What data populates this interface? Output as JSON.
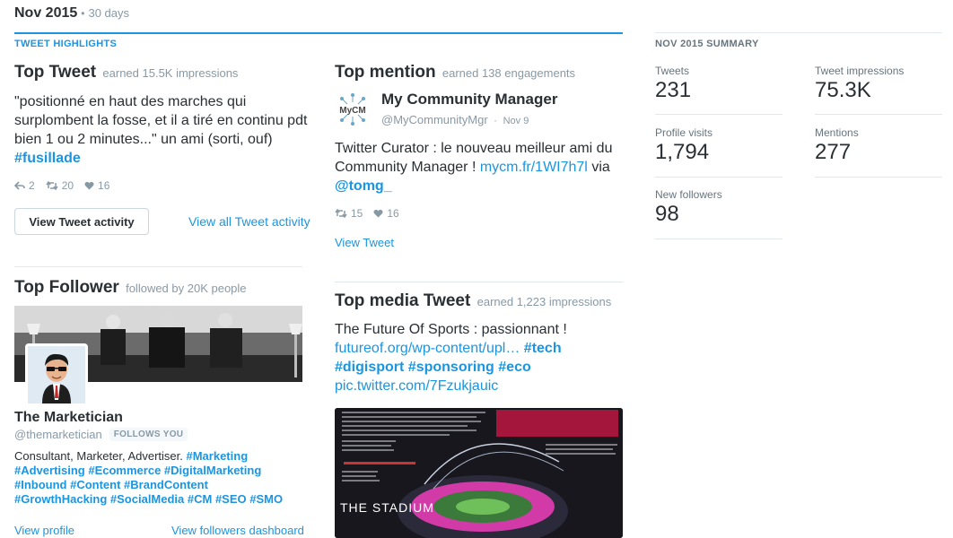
{
  "header": {
    "month": "Nov 2015",
    "separator": "•",
    "period": "30 days"
  },
  "highlights": {
    "label": "TWEET HIGHLIGHTS",
    "top_tweet": {
      "title": "Top Tweet",
      "subtitle": "earned 15.5K impressions",
      "text_plain": "\"positionné en haut des marches qui surplombent la fosse, et il a tiré en continu pdt bien 1 ou 2 minutes...\" un ami (sorti, ouf)",
      "hashtag": "#fusillade",
      "replies": "2",
      "retweets": "20",
      "likes": "16",
      "button_label": "View Tweet activity",
      "all_link": "View all Tweet activity"
    },
    "top_mention": {
      "title": "Top mention",
      "subtitle": "earned 138 engagements",
      "author_name": "My Community Manager",
      "author_handle": "@MyCommunityMgr",
      "date": "Nov 9",
      "logo_text": "MyCM",
      "text_plain": "Twitter Curator : le nouveau meilleur ami du Community Manager !",
      "link": "mycm.fr/1WI7h7l",
      "via": "via",
      "mention": "@tomg_",
      "retweets": "15",
      "likes": "16",
      "view_link": "View Tweet"
    },
    "top_follower": {
      "title": "Top Follower",
      "subtitle": "followed by 20K people",
      "name": "The Marketician",
      "handle": "@themarketician",
      "follows_you": "FOLLOWS YOU",
      "bio_plain": "Consultant, Marketer, Advertiser.",
      "bio_tags_1": "#Marketing",
      "bio_tags_2": "#Advertising #Ecommerce #DigitalMarketing",
      "bio_tags_3": "#Inbound #Content #BrandContent",
      "bio_tags_4": "#GrowthHacking #SocialMedia #CM #SEO #SMO",
      "view_profile": "View profile",
      "view_dashboard": "View followers dashboard"
    },
    "top_media": {
      "title": "Top media Tweet",
      "subtitle": "earned 1,223 impressions",
      "text_plain": "The Future Of Sports : passionnant !",
      "link1": "futureof.org/wp-content/upl…",
      "tag1": "#tech",
      "tag2": "#digisport",
      "tag3": "#sponsoring",
      "tag4": "#eco",
      "link2": "pic.twitter.com/7Fzukjauic",
      "image_caption": "THE STADIUM"
    }
  },
  "summary": {
    "label": "NOV 2015 SUMMARY",
    "tweets": {
      "label": "Tweets",
      "value": "231"
    },
    "impressions": {
      "label": "Tweet impressions",
      "value": "75.3K"
    },
    "profile_visits": {
      "label": "Profile visits",
      "value": "1,794"
    },
    "mentions": {
      "label": "Mentions",
      "value": "277"
    },
    "new_followers": {
      "label": "New followers",
      "value": "98"
    }
  },
  "colors": {
    "accent": "#1b95e0",
    "text": "#292f33",
    "muted": "#8899a6",
    "divider": "#e1e8ed"
  }
}
